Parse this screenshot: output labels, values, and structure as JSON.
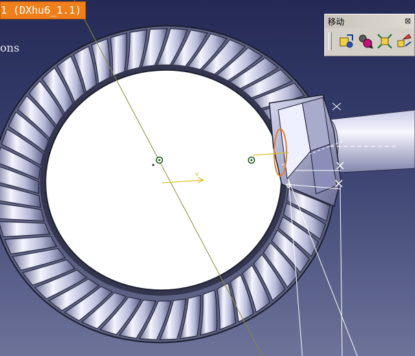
{
  "window": {
    "tree_node_label": "1 (DXhu6_1.1)",
    "tree_label_fragment": "ons"
  },
  "toolbar": {
    "title": "移动",
    "close_glyph": "⊠",
    "buttons": [
      {
        "name": "manipulation-icon"
      },
      {
        "name": "snap-icon"
      },
      {
        "name": "smart-move-icon"
      },
      {
        "name": "explode-icon"
      }
    ]
  },
  "viewport": {
    "axis_label": "v",
    "colors": {
      "tooth_light": "#eef0ff",
      "tooth_shade": "#8a8eb8",
      "gear_outline": "#1c1e2e",
      "highlight": "#e87a2a",
      "axis": "#d8c020"
    }
  }
}
